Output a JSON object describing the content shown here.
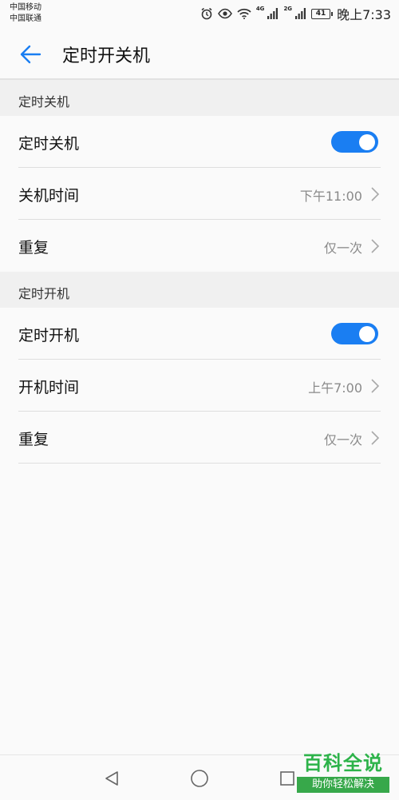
{
  "status_bar": {
    "carrier_1": "中国移动",
    "carrier_2": "中国联通",
    "network_1": "4G",
    "network_2": "2G",
    "battery": "41",
    "time": "晚上7:33",
    "icons": [
      "alarm-icon",
      "eye-comfort-icon",
      "wifi-icon",
      "signal-icon",
      "signal-icon",
      "battery-icon"
    ]
  },
  "app_bar": {
    "back_icon": "arrow-left-icon",
    "title": "定时开关机"
  },
  "shutdown_section": {
    "header": "定时关机",
    "toggle_label": "定时关机",
    "toggle_on": true,
    "time_label": "关机时间",
    "time_value": "下午11:00",
    "repeat_label": "重复",
    "repeat_value": "仅一次"
  },
  "poweron_section": {
    "header": "定时开机",
    "toggle_label": "定时开机",
    "toggle_on": true,
    "time_label": "开机时间",
    "time_value": "上午7:00",
    "repeat_label": "重复",
    "repeat_value": "仅一次"
  },
  "nav_bar": {
    "icons": [
      "back-triangle-icon",
      "home-circle-icon",
      "recents-square-icon"
    ]
  },
  "watermark": {
    "title": "百科全说",
    "subtitle": "助你轻松解决"
  },
  "colors": {
    "accent": "#1a7ef2",
    "background": "#fafafa",
    "section_header_bg": "#f0f0f0",
    "secondary_text": "#8a8a8a",
    "watermark_green": "#2db34a"
  }
}
